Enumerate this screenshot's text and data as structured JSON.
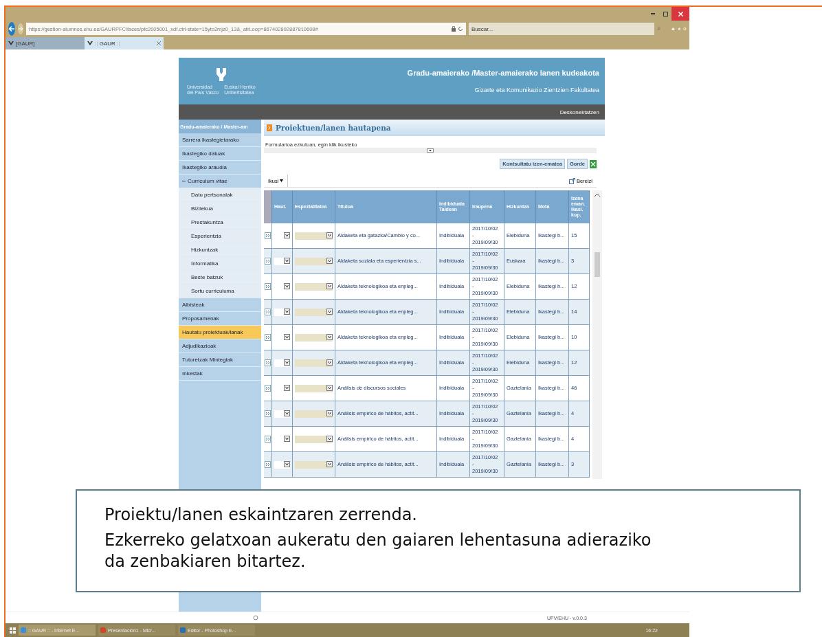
{
  "browser": {
    "url": "https://gestion-alumnos.ehu.es/GAURPFC/faces/pfc2005001_xdf.ctrl-state=15yto2mjz0_13&_afrLoop=867402892887810608#",
    "search": {
      "placeholder": "Buscar..."
    },
    "tabs": [
      {
        "label": "[GAUR]",
        "selected": false
      },
      {
        "label": ":: GAUR ::",
        "selected": true
      }
    ]
  },
  "header": {
    "title": "Gradu-amaierako /Master-amaierako lanen kudeakota",
    "subtitle": "Gizarte eta Komunikazio Zientzien Fakultatea",
    "logo_left": "Universidad\ndel País Vasco",
    "logo_right": "Euskal Herriko\nUnibertsitatea",
    "logout": "Deskonektatzen"
  },
  "sidebar": {
    "title": "Gradu-amaierako / Master-am",
    "items": [
      {
        "label": "Sarrera ikastegietarako",
        "selected": false
      },
      {
        "label": "Ikastegiko datuak",
        "selected": false
      },
      {
        "label": "Ikastegiko araudia",
        "selected": false
      },
      {
        "label": "Curriculum vitae",
        "selected": false,
        "expanded": true,
        "children": [
          {
            "label": "Datu pertsonalak",
            "selected": false
          },
          {
            "label": "Bizilekua",
            "selected": false
          },
          {
            "label": "Prestakuntza",
            "selected": false
          },
          {
            "label": "Esperientzia",
            "selected": false
          },
          {
            "label": "Hizkuntzak",
            "selected": false
          },
          {
            "label": "Informatika",
            "selected": false
          },
          {
            "label": "Beste batzuk",
            "selected": false
          },
          {
            "label": "Sortu curriculuma",
            "selected": false
          }
        ]
      },
      {
        "label": "Albisteak",
        "selected": false
      },
      {
        "label": "Proposamenak",
        "selected": false
      },
      {
        "label": "Hautatu proiektuak/lanak",
        "selected": true
      },
      {
        "label": "Adjudikazioak",
        "selected": false
      },
      {
        "label": "Tutoretzak Mintegiak",
        "selected": false
      },
      {
        "label": "Inkestak",
        "selected": false
      }
    ]
  },
  "main": {
    "title": "Proiektuen/lanen hautapena",
    "form_hint": "Formularioa ezkutuan, egin klik ikusteko",
    "buttons": [
      "Kontsultatu izen-ematea",
      "Gorde"
    ],
    "view_menu": "Ikusi",
    "detach": "Bereizi",
    "table": {
      "columns": [
        "Haut.",
        "Espezialitatea",
        "Titulua",
        "Indibiduala\nTaldean",
        "Iraupena",
        "Hizkuntza",
        "Mota",
        "Izena\neman.\nikasl.\nkop."
      ],
      "rows": [
        {
          "title": "Aldaketa eta gatazka/Cambio y co...",
          "mode": "Indibiduala",
          "period": "2017/10/02\n-\n2019/09/30",
          "language": "Elebiduna",
          "type": "Ikastegi b...",
          "count": "15"
        },
        {
          "title": "Aldaketa soziala eta esperientzia s...",
          "mode": "Indibiduala",
          "period": "2017/10/02\n-\n2019/09/30",
          "language": "Euskara",
          "type": "Ikastegi b...",
          "count": "3"
        },
        {
          "title": "Aldaketa teknologikoa eta enpleg...",
          "mode": "Indibiduala",
          "period": "2017/10/02\n-\n2019/09/30",
          "language": "Elebiduna",
          "type": "Ikastegi b...",
          "count": "12"
        },
        {
          "title": "Aldaketa teknologikoa eta enpleg...",
          "mode": "Indibiduala",
          "period": "2017/10/02\n-\n2019/09/30",
          "language": "Elebiduna",
          "type": "Ikastegi b...",
          "count": "14"
        },
        {
          "title": "Aldaketa teknologikoa eta enpleg...",
          "mode": "Indibiduala",
          "period": "2017/10/02\n-\n2019/09/30",
          "language": "Elebiduna",
          "type": "Ikastegi b...",
          "count": "10"
        },
        {
          "title": "Aldaketa teknologikoa eta enpleg...",
          "mode": "Indibiduala",
          "period": "2017/10/02\n-\n2019/09/30",
          "language": "Elebiduna",
          "type": "Ikastegi b...",
          "count": "12"
        },
        {
          "title": "Análisis de discursos sociales",
          "mode": "Indibiduala",
          "period": "2017/10/02\n-\n2019/09/30",
          "language": "Gaztelania",
          "type": "Ikastegi b...",
          "count": "46"
        },
        {
          "title": "Análisis empírico de hábitos, actit...",
          "mode": "Indibiduala",
          "period": "2017/10/02\n-\n2019/09/30",
          "language": "Gaztelania",
          "type": "Ikastegi b...",
          "count": "4"
        },
        {
          "title": "Análisis empírico de hábitos, actit...",
          "mode": "Indibiduala",
          "period": "2017/10/02\n-\n2019/09/30",
          "language": "Gaztelania",
          "type": "Ikastegi b...",
          "count": "4"
        },
        {
          "title": "Análisis empírico de hábitos, actit...",
          "mode": "Indibiduala",
          "period": "2017/10/02\n-\n2019/09/30",
          "language": "Gaztelania",
          "type": "Ikastegi b...",
          "count": "3"
        }
      ]
    }
  },
  "status_bar": {
    "version": "UPV/EHU - v.0.0.3"
  },
  "callout": {
    "paragraphs": [
      "Proiektu/lanen eskaintzaren zerrenda.",
      "Ezkerreko gelatxoan aukeratu den gaiaren lehentasuna adieraziko da zenbakiaren bitartez."
    ]
  },
  "taskbar": {
    "tasks": [
      {
        "label": ":: GAUR :: - Internet E...",
        "selected": true
      },
      {
        "label": "Presentación1 - Micr...",
        "selected": false
      },
      {
        "label": "Editor - Photoshop E...",
        "selected": false
      }
    ],
    "clock": "16:22"
  }
}
